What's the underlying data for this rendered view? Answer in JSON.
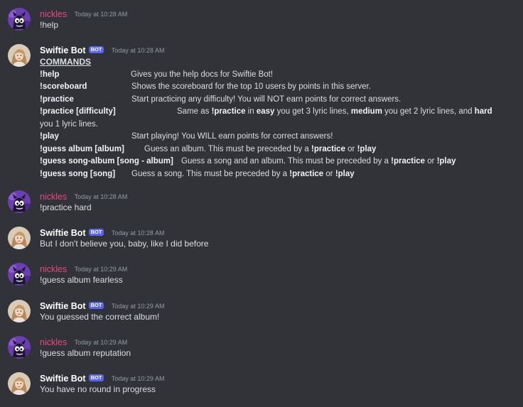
{
  "messages": [
    {
      "author": "nickles",
      "timestamp": "Today at 10:28 AM",
      "text": "!help"
    },
    {
      "author": "Swiftie Bot",
      "badge": "BOT",
      "timestamp": "Today at 10:28 AM"
    },
    {
      "author": "nickles",
      "timestamp": "Today at 10:28 AM",
      "text": "!practice hard"
    },
    {
      "author": "Swiftie Bot",
      "badge": "BOT",
      "timestamp": "Today at 10:28 AM",
      "text": "But I don't believe you, baby, like I did before"
    },
    {
      "author": "nickles",
      "timestamp": "Today at 10:29 AM",
      "text": "!guess album fearless"
    },
    {
      "author": "Swiftie Bot",
      "badge": "BOT",
      "timestamp": "Today at 10:29 AM",
      "text": "You guessed the correct album!"
    },
    {
      "author": "nickles",
      "timestamp": "Today at 10:29 AM",
      "text": "!guess album reputation"
    },
    {
      "author": "Swiftie Bot",
      "badge": "BOT",
      "timestamp": "Today at 10:29 AM",
      "text": "You have no round in progress"
    }
  ],
  "help": {
    "title": "COMMANDS",
    "commands": [
      {
        "cmd": "!help",
        "desc": "Gives you the help docs for Swiftie Bot!"
      },
      {
        "cmd": "!scoreboard",
        "desc": "Shows the scoreboard for the top 10 users by points in this server."
      },
      {
        "cmd": "!practice",
        "desc": "Start practicing any difficulty! You will NOT earn points for correct answers."
      },
      {
        "cmd": "!practice [difficulty]",
        "desc_parts": [
          "Same as ",
          "!practice",
          " in ",
          "easy",
          " you get 3 lyric lines, ",
          "medium",
          " you get 2 lyric lines, and ",
          "hard"
        ],
        "wrap": "you 1 lyric lines."
      },
      {
        "cmd": "!play",
        "desc": "Start playing! You WILL earn points for correct answers!"
      },
      {
        "cmd": "!guess album [album]",
        "desc_parts": [
          "Guess an album. This must be preceded by a ",
          "!practice",
          " or ",
          "!play"
        ]
      },
      {
        "cmd": "!guess song-album [song - album]",
        "desc_parts": [
          "Guess a song and an album. This must be preceded by a ",
          "!practice",
          " or ",
          "!play"
        ]
      },
      {
        "cmd": "!guess song [song]",
        "desc_parts": [
          "Guess a song. This must be preceded by a ",
          "!practice",
          " or ",
          "!play"
        ]
      }
    ]
  },
  "colors": {
    "background": "#313338",
    "nickles_name": "#e8487a",
    "bot_badge": "#5865f2",
    "timestamp": "#949ba4"
  },
  "icons": {
    "nickles_avatar": "cartoon-character-avatar-icon",
    "bot_avatar": "person-photo-avatar-icon"
  }
}
